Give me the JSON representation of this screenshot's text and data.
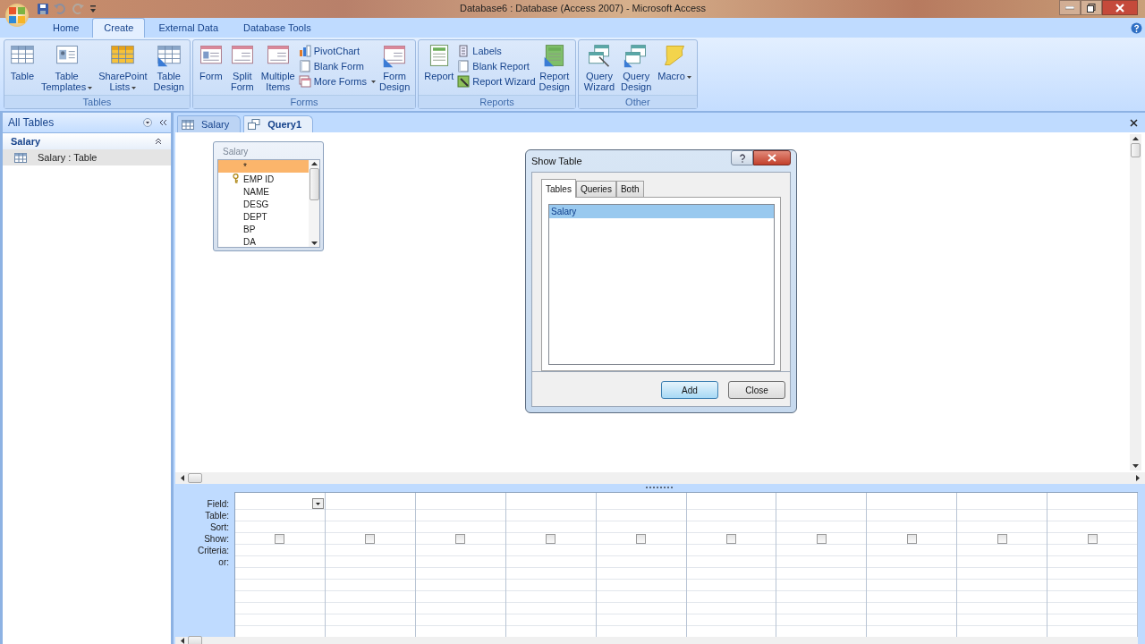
{
  "window": {
    "title": "Database6 : Database (Access 2007) - Microsoft Access"
  },
  "ribbon": {
    "tabs": [
      {
        "label": "Home",
        "selected": false
      },
      {
        "label": "Create",
        "selected": true
      },
      {
        "label": "External Data",
        "selected": false
      },
      {
        "label": "Database Tools",
        "selected": false
      }
    ],
    "groups": [
      {
        "label": "Tables",
        "items": [
          {
            "kind": "large",
            "lines": [
              "Table"
            ],
            "dropdown": false
          },
          {
            "kind": "large",
            "lines": [
              "Table",
              "Templates"
            ],
            "dropdown": true
          },
          {
            "kind": "large",
            "lines": [
              "SharePoint",
              "Lists"
            ],
            "dropdown": true
          },
          {
            "kind": "large",
            "lines": [
              "Table",
              "Design"
            ],
            "dropdown": false
          }
        ]
      },
      {
        "label": "Forms",
        "items": [
          {
            "kind": "large",
            "lines": [
              "Form"
            ],
            "dropdown": false
          },
          {
            "kind": "large",
            "lines": [
              "Split",
              "Form"
            ],
            "dropdown": false
          },
          {
            "kind": "large",
            "lines": [
              "Multiple",
              "Items"
            ],
            "dropdown": false
          },
          {
            "kind": "small",
            "lines": [
              "PivotChart"
            ],
            "dropdown": false
          },
          {
            "kind": "small",
            "lines": [
              "Blank Form"
            ],
            "dropdown": false
          },
          {
            "kind": "small",
            "lines": [
              "More Forms"
            ],
            "dropdown": true
          },
          {
            "kind": "large",
            "lines": [
              "Form",
              "Design"
            ],
            "dropdown": false
          }
        ]
      },
      {
        "label": "Reports",
        "items": [
          {
            "kind": "large",
            "lines": [
              "Report"
            ],
            "dropdown": false
          },
          {
            "kind": "small",
            "lines": [
              "Labels"
            ],
            "dropdown": false
          },
          {
            "kind": "small",
            "lines": [
              "Blank Report"
            ],
            "dropdown": false
          },
          {
            "kind": "small",
            "lines": [
              "Report Wizard"
            ],
            "dropdown": false
          },
          {
            "kind": "large",
            "lines": [
              "Report",
              "Design"
            ],
            "dropdown": false
          }
        ]
      },
      {
        "label": "Other",
        "items": [
          {
            "kind": "large",
            "lines": [
              "Query",
              "Wizard"
            ],
            "dropdown": false
          },
          {
            "kind": "large",
            "lines": [
              "Query",
              "Design"
            ],
            "dropdown": false
          },
          {
            "kind": "large",
            "lines": [
              "Macro"
            ],
            "dropdown": true
          }
        ]
      }
    ]
  },
  "nav_pane": {
    "title": "All Tables",
    "group": "Salary",
    "items": [
      {
        "label": "Salary : Table",
        "selected": true
      }
    ]
  },
  "doc_tabs": [
    {
      "label": "Salary",
      "kind": "table",
      "selected": false
    },
    {
      "label": "Query1",
      "kind": "query",
      "selected": true
    }
  ],
  "field_list": {
    "title": "Salary",
    "fields": [
      {
        "label": "*",
        "primary_key": false,
        "selected": true
      },
      {
        "label": "EMP ID",
        "primary_key": true,
        "selected": false
      },
      {
        "label": "NAME",
        "primary_key": false,
        "selected": false
      },
      {
        "label": "DESG",
        "primary_key": false,
        "selected": false
      },
      {
        "label": "DEPT",
        "primary_key": false,
        "selected": false
      },
      {
        "label": "BP",
        "primary_key": false,
        "selected": false
      },
      {
        "label": "DA",
        "primary_key": false,
        "selected": false
      }
    ]
  },
  "dialog": {
    "title": "Show Table",
    "tabs": [
      {
        "label": "Tables",
        "selected": true
      },
      {
        "label": "Queries",
        "selected": false
      },
      {
        "label": "Both",
        "selected": false
      }
    ],
    "items": [
      {
        "label": "Salary",
        "selected": true
      }
    ],
    "buttons": [
      {
        "label": "Add",
        "default": true
      },
      {
        "label": "Close",
        "default": false
      }
    ]
  },
  "grid": {
    "row_labels": [
      "Field:",
      "Table:",
      "Sort:",
      "Show:",
      "Criteria:",
      "or:"
    ],
    "columns": [
      {
        "show_checked": false
      },
      {
        "show_checked": false
      },
      {
        "show_checked": false
      },
      {
        "show_checked": false
      },
      {
        "show_checked": false
      },
      {
        "show_checked": false
      },
      {
        "show_checked": false
      },
      {
        "show_checked": false
      },
      {
        "show_checked": false
      },
      {
        "show_checked": false
      }
    ]
  }
}
